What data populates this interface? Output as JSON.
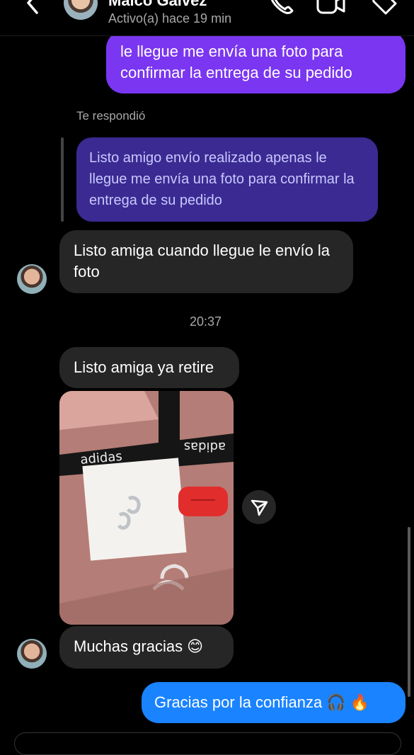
{
  "header": {
    "contact_name": "Maico Galvez",
    "status": "Activo(a) hace 19 min",
    "icons": [
      "back-icon",
      "phone-icon",
      "video-camera-icon",
      "tag-icon"
    ]
  },
  "messages": {
    "sent_top": "le llegue me envía una foto para confirmar la entrega de su pedido",
    "reply_label": "Te respondió",
    "reply_preview": "Listo amigo envío realizado apenas le llegue me envía una foto para confirmar la entrega de su pedido",
    "received_1": "Listo amiga cuando llegue le envío la foto",
    "timestamp": "20:37",
    "received_2": "Listo amiga ya retire",
    "received_3": "Muchas gracias 😊",
    "sent_last": "Gracias por la confianza 🎧 🔥"
  },
  "photo": {
    "brand_text": "adidas"
  },
  "colors": {
    "background": "#000000",
    "sent_bubble": "#7a36f1",
    "received_bubble": "#262626",
    "reply_bubble": "#3a2a91",
    "blue_bubble": "#1a83ff"
  }
}
